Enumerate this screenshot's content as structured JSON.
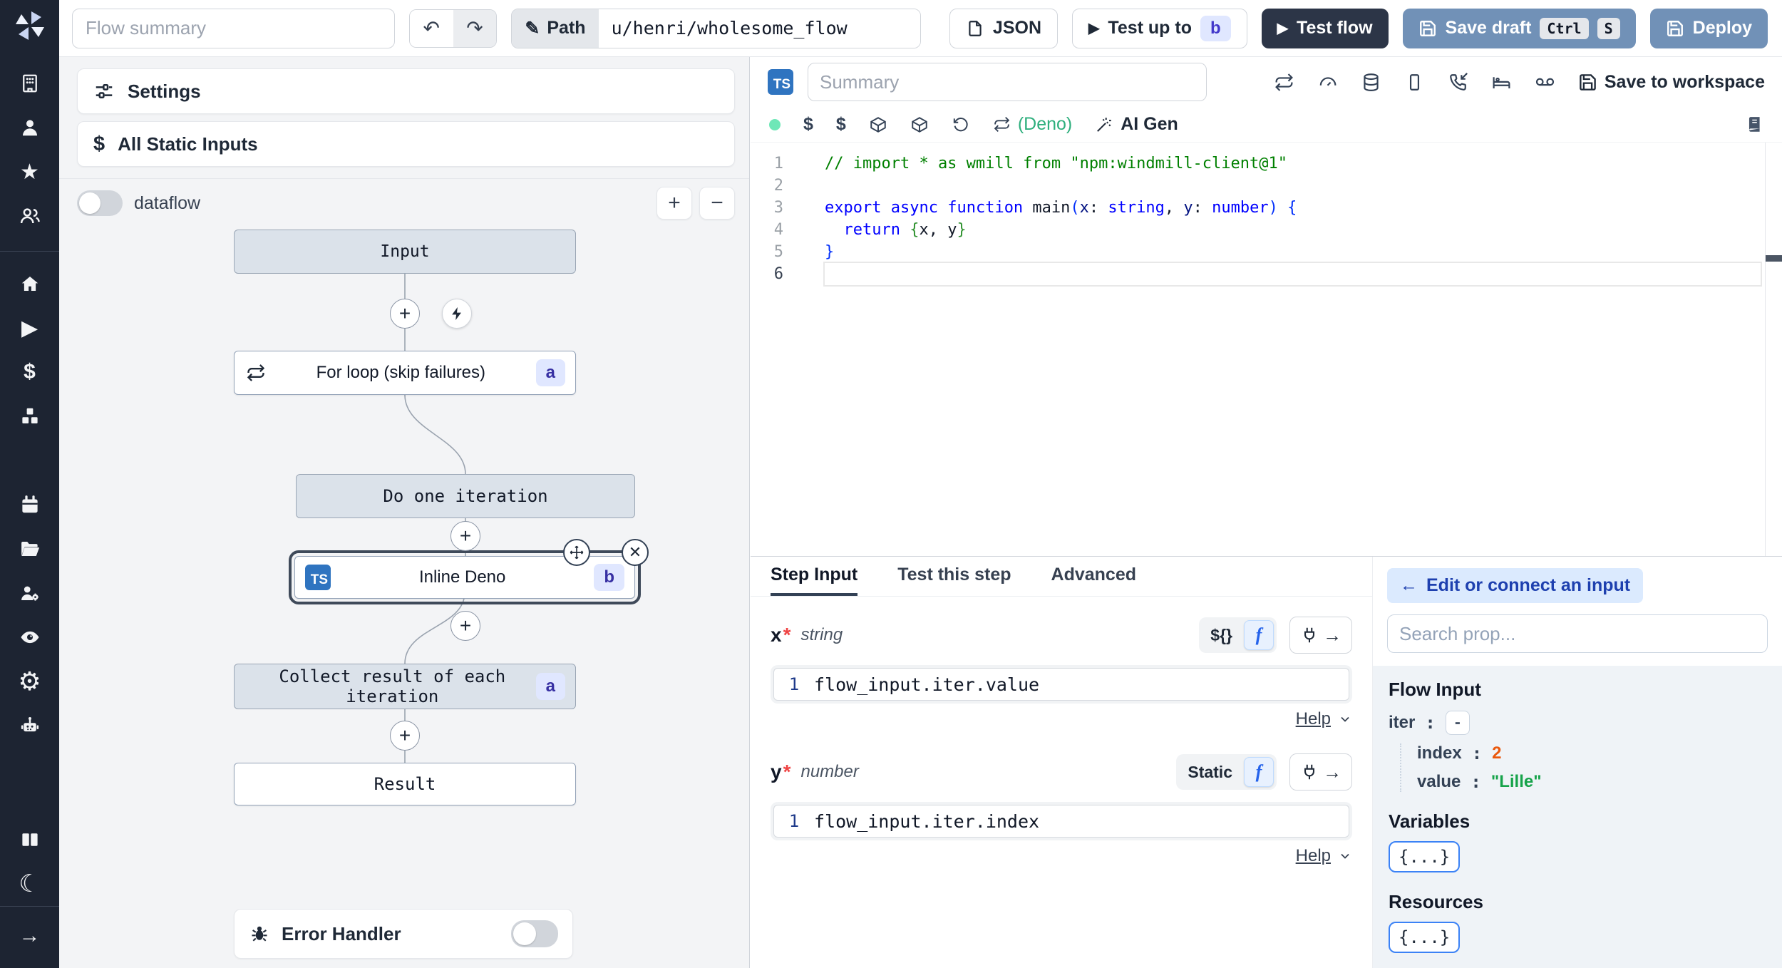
{
  "colors": {
    "rail_bg": "#1d2432",
    "primary_button": "#7191b7",
    "dark_button": "#2c3547",
    "badge_bg": "#e0e7ff",
    "badge_text": "#4338ca",
    "selected_outline": "#3f4a5a",
    "deno_green": "#2eaf7d",
    "status_dot": "#6ee7b7",
    "link_blue": "#1e40af",
    "index_orange": "#ea580c",
    "value_green": "#16a34a"
  },
  "icons": {
    "pencil": "✎",
    "undo": "↶",
    "redo": "↷",
    "play": "▶",
    "plus": "+",
    "close": "✕",
    "dollar": "$",
    "star": "★",
    "gear": "⚙",
    "moon": "☾",
    "arrow_right": "→",
    "arrow_left": "←",
    "minus": "−"
  },
  "topbar": {
    "flow_summary_placeholder": "Flow summary",
    "path_label": "Path",
    "path_value": "u/henri/wholesome_flow",
    "json_button": "JSON",
    "test_up_to": "Test up to",
    "test_up_to_badge": "b",
    "test_flow": "Test flow",
    "save_draft": "Save draft",
    "kbd_ctrl": "Ctrl",
    "kbd_s": "S",
    "deploy": "Deploy"
  },
  "flow_panel": {
    "settings_label": "Settings",
    "static_inputs_label": "All Static Inputs",
    "dataflow_label": "dataflow",
    "zoom_in": "+",
    "zoom_out": "−",
    "nodes": {
      "input": "Input",
      "for_loop": "For loop (skip failures)",
      "for_loop_badge": "a",
      "iteration": "Do one iteration",
      "inline_lang": "TS",
      "inline": "Inline Deno",
      "inline_badge": "b",
      "collect": "Collect result of each iteration",
      "collect_badge": "a",
      "result": "Result"
    },
    "error_handler_label": "Error Handler"
  },
  "editor": {
    "lang_badge": "TS",
    "summary_placeholder": "Summary",
    "runtime_label": "(Deno)",
    "ai_gen_label": "AI Gen",
    "save_to_workspace_label": "Save to workspace",
    "code_lines": [
      {
        "n": "1",
        "tokens": [
          {
            "t": "// import * as wmill from \"npm:windmill-client@1\"",
            "c": "cmt"
          }
        ]
      },
      {
        "n": "2",
        "tokens": []
      },
      {
        "n": "3",
        "tokens": [
          {
            "t": "export",
            "c": "kw"
          },
          {
            "t": " ",
            "c": "pln"
          },
          {
            "t": "async",
            "c": "kw"
          },
          {
            "t": " ",
            "c": "pln"
          },
          {
            "t": "function",
            "c": "kw"
          },
          {
            "t": " main",
            "c": "pln"
          },
          {
            "t": "(",
            "c": "br1"
          },
          {
            "t": "x",
            "c": "param"
          },
          {
            "t": ": ",
            "c": "pln"
          },
          {
            "t": "string",
            "c": "kw"
          },
          {
            "t": ", ",
            "c": "pln"
          },
          {
            "t": "y",
            "c": "param"
          },
          {
            "t": ": ",
            "c": "pln"
          },
          {
            "t": "number",
            "c": "kw"
          },
          {
            "t": ")",
            "c": "br1"
          },
          {
            "t": " ",
            "c": "pln"
          },
          {
            "t": "{",
            "c": "br1"
          }
        ]
      },
      {
        "n": "4",
        "tokens": [
          {
            "t": "  ",
            "c": "pln"
          },
          {
            "t": "return",
            "c": "kw"
          },
          {
            "t": " ",
            "c": "pln"
          },
          {
            "t": "{",
            "c": "br2"
          },
          {
            "t": "x, y",
            "c": "pln"
          },
          {
            "t": "}",
            "c": "br2"
          }
        ]
      },
      {
        "n": "5",
        "tokens": [
          {
            "t": "}",
            "c": "br1"
          }
        ]
      },
      {
        "n": "6",
        "tokens": [],
        "active": true
      }
    ]
  },
  "step_panel": {
    "tabs": [
      "Step Input",
      "Test this step",
      "Advanced"
    ],
    "active_tab": "Step Input",
    "fields": [
      {
        "name": "x",
        "required": "*",
        "type": "string",
        "mode_label": "${}",
        "mode_icon": "f",
        "line_no": "1",
        "expr": "flow_input.iter.value",
        "help_label": "Help"
      },
      {
        "name": "y",
        "required": "*",
        "type": "number",
        "mode_label": "Static",
        "mode_icon": "f",
        "line_no": "1",
        "expr": "flow_input.iter.index",
        "help_label": "Help"
      }
    ]
  },
  "context_panel": {
    "edit_connect_label": "Edit or connect an input",
    "search_placeholder": "Search prop...",
    "flow_input_title": "Flow Input",
    "props": {
      "iter_key": "iter",
      "iter_value": "-",
      "index_key": "index",
      "index_value": "2",
      "value_key": "value",
      "value_value": "\"Lille\""
    },
    "variables_title": "Variables",
    "resources_title": "Resources",
    "object_preview": "{...}"
  }
}
